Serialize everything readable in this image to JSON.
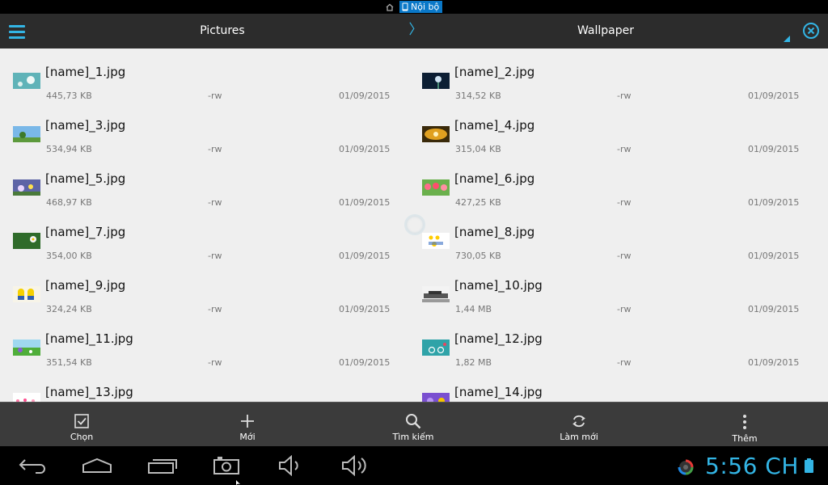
{
  "status": {
    "storage_label": "Nội bộ"
  },
  "header": {
    "crumb_parent": "Pictures",
    "crumb_separator": "〉",
    "crumb_current": "Wallpaper"
  },
  "files": [
    [
      {
        "name": "[name]_1.jpg",
        "size": "445,73 KB",
        "perm": "-rw",
        "date": "01/09/2015",
        "thumb": "dandelion-teal"
      },
      {
        "name": "[name]_2.jpg",
        "size": "314,52 KB",
        "perm": "-rw",
        "date": "01/09/2015",
        "thumb": "dark-dandelion"
      }
    ],
    [
      {
        "name": "[name]_3.jpg",
        "size": "534,94 KB",
        "perm": "-rw",
        "date": "01/09/2015",
        "thumb": "sky-tree"
      },
      {
        "name": "[name]_4.jpg",
        "size": "315,04 KB",
        "perm": "-rw",
        "date": "01/09/2015",
        "thumb": "sunset"
      }
    ],
    [
      {
        "name": "[name]_5.jpg",
        "size": "468,97 KB",
        "perm": "-rw",
        "date": "01/09/2015",
        "thumb": "flowers-purple"
      },
      {
        "name": "[name]_6.jpg",
        "size": "427,25 KB",
        "perm": "-rw",
        "date": "01/09/2015",
        "thumb": "tulips"
      }
    ],
    [
      {
        "name": "[name]_7.jpg",
        "size": "354,00 KB",
        "perm": "-rw",
        "date": "01/09/2015",
        "thumb": "grass-flower"
      },
      {
        "name": "[name]_8.jpg",
        "size": "730,05 KB",
        "perm": "-rw",
        "date": "01/09/2015",
        "thumb": "minions-white"
      }
    ],
    [
      {
        "name": "[name]_9.jpg",
        "size": "324,24 KB",
        "perm": "-rw",
        "date": "01/09/2015",
        "thumb": "minions"
      },
      {
        "name": "[name]_10.jpg",
        "size": "1,44 MB",
        "perm": "-rw",
        "date": "01/09/2015",
        "thumb": "car"
      }
    ],
    [
      {
        "name": "[name]_11.jpg",
        "size": "351,54 KB",
        "perm": "-rw",
        "date": "01/09/2015",
        "thumb": "meadow"
      },
      {
        "name": "[name]_12.jpg",
        "size": "1,82 MB",
        "perm": "-rw",
        "date": "01/09/2015",
        "thumb": "teal-bike"
      }
    ],
    [
      {
        "name": "[name]_13.jpg",
        "size": "",
        "perm": "",
        "date": "",
        "thumb": "pink"
      },
      {
        "name": "[name]_14.jpg",
        "size": "",
        "perm": "",
        "date": "",
        "thumb": "purple"
      }
    ]
  ],
  "actions": [
    {
      "label": "Chọn",
      "icon": "select-checkbox-icon"
    },
    {
      "label": "Mới",
      "icon": "plus-icon"
    },
    {
      "label": "Tìm kiếm",
      "icon": "search-icon"
    },
    {
      "label": "Làm mới",
      "icon": "refresh-icon"
    },
    {
      "label": "Thêm",
      "icon": "more-vert-icon"
    }
  ],
  "navbar": {
    "clock": "5:56 CH"
  },
  "colors": {
    "accent": "#33b5e5",
    "header_bg": "#2c2c2c",
    "list_bg": "#efefef",
    "actionbar_bg": "#3b3b3b",
    "storage_badge": "#0a78c8"
  }
}
